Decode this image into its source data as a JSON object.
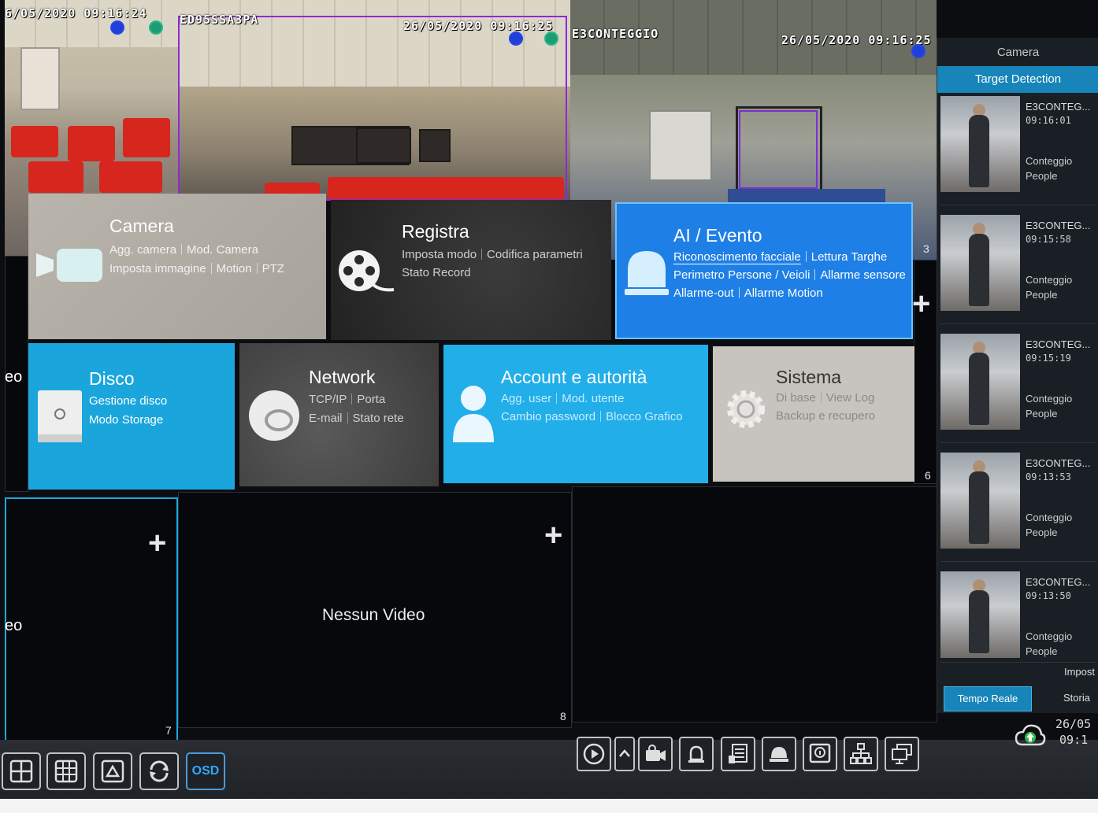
{
  "feeds": {
    "feed1_stamp": "6/05/2020 09:16:24",
    "feed2_stamp_left": "ED95SSA3PA",
    "feed2_stamp_right": "26/05/2020 09:16:25",
    "feed3_title": "E3CONTEGGIO",
    "feed3_stamp": "26/05/2020 09:16:25"
  },
  "grid": {
    "cell3_num": "3",
    "cell6_num": "6",
    "cell7_num": "7",
    "cell8_num": "8",
    "no_video": "Nessun Video",
    "left_text_1": "eo",
    "left_text_2": "eo",
    "plus": "+"
  },
  "menu": {
    "camera": {
      "title": "Camera",
      "items": [
        "Agg. camera",
        "Mod. Camera",
        "Imposta immagine",
        "Motion",
        "PTZ"
      ]
    },
    "registra": {
      "title": "Registra",
      "items": [
        "Imposta modo",
        "Codifica parametri",
        "Stato Record"
      ]
    },
    "ai": {
      "title": "AI / Evento",
      "items": [
        "Riconoscimento facciale",
        "Lettura Targhe",
        "Perimetro Persone / Veioli",
        "Allarme sensore",
        "Allarme-out",
        "Allarme Motion"
      ]
    },
    "disco": {
      "title": "Disco",
      "items": [
        "Gestione disco",
        "Modo Storage"
      ]
    },
    "network": {
      "title": "Network",
      "items": [
        "TCP/IP",
        "Porta",
        "E-mail",
        "Stato rete"
      ]
    },
    "account": {
      "title": "Account e autorità",
      "items": [
        "Agg. user",
        "Mod. utente",
        "Cambio password",
        "Blocco Grafico"
      ]
    },
    "sistema": {
      "title": "Sistema",
      "items": [
        "Di base",
        "View Log",
        "Backup e recupero"
      ]
    }
  },
  "right_panel": {
    "title": "Camera",
    "tab": "Target Detection",
    "detections": [
      {
        "name": "E3CONTEG...",
        "time": "09:16:01",
        "line1": "Conteggio",
        "line2": "People"
      },
      {
        "name": "E3CONTEG...",
        "time": "09:15:58",
        "line1": "Conteggio",
        "line2": "People"
      },
      {
        "name": "E3CONTEG...",
        "time": "09:15:19",
        "line1": "Conteggio",
        "line2": "People"
      },
      {
        "name": "E3CONTEG...",
        "time": "09:13:53",
        "line1": "Conteggio",
        "line2": "People"
      },
      {
        "name": "E3CONTEG...",
        "time": "09:13:50",
        "line1": "Conteggio",
        "line2": "People"
      }
    ],
    "impost": "Impost",
    "live_label": "Tempo Reale",
    "history_label": "Storia"
  },
  "bottom": {
    "osd_label": "OSD",
    "clock_date": "26/05",
    "clock_time": "09:1"
  },
  "icons": [
    "layout-4-icon",
    "layout-9-icon",
    "sequence-icon",
    "rotate-icon",
    "play-icon",
    "chevron-up-icon",
    "camera-ai-icon",
    "alarm-icon",
    "list-icon",
    "dome-camera-icon",
    "info-icon",
    "network-tree-icon",
    "monitor-icon",
    "cloud-upload-icon"
  ],
  "colors": {
    "accent": "#1da8e0",
    "ai_tile": "#1e7fe6",
    "disco_tile": "#1aa6dd",
    "account_tile": "#21aee9",
    "active_tab": "#1785b9"
  }
}
